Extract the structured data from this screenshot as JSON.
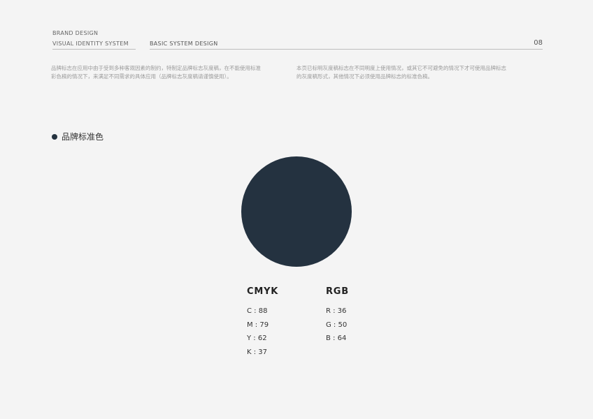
{
  "header": {
    "brand_design": "BRAND DESIGN",
    "visual_identity": "VISUAL IDENTITY SYSTEM",
    "basic_system": "BASIC SYSTEM DESIGN",
    "page_number": "08"
  },
  "description": {
    "left_line1": "品牌标志在应用中由于受到多种客观因素的制约，特制定品牌标志灰度稿，在不能使用标准",
    "left_line2": "彩色稿的情况下，来满足不同需求的具体应用（品牌标志灰度稿请谨慎使用）。",
    "right_line1": "本页已标明灰度稿标志在不同明度上使用情况，或其它不可避免的情况下才可使用品牌标志",
    "right_line2": "的灰度稿形式，其他情况下必须使用品牌标志的标准色稿。"
  },
  "section": {
    "title": "品牌标准色"
  },
  "color": {
    "swatch_hex": "#243240",
    "cmyk_title": "CMYK",
    "cmyk_values": [
      "C : 88",
      "M : 79",
      "Y : 62",
      "K : 37"
    ],
    "rgb_title": "RGB",
    "rgb_values": [
      "R : 36",
      "G : 50",
      "B : 64"
    ]
  }
}
